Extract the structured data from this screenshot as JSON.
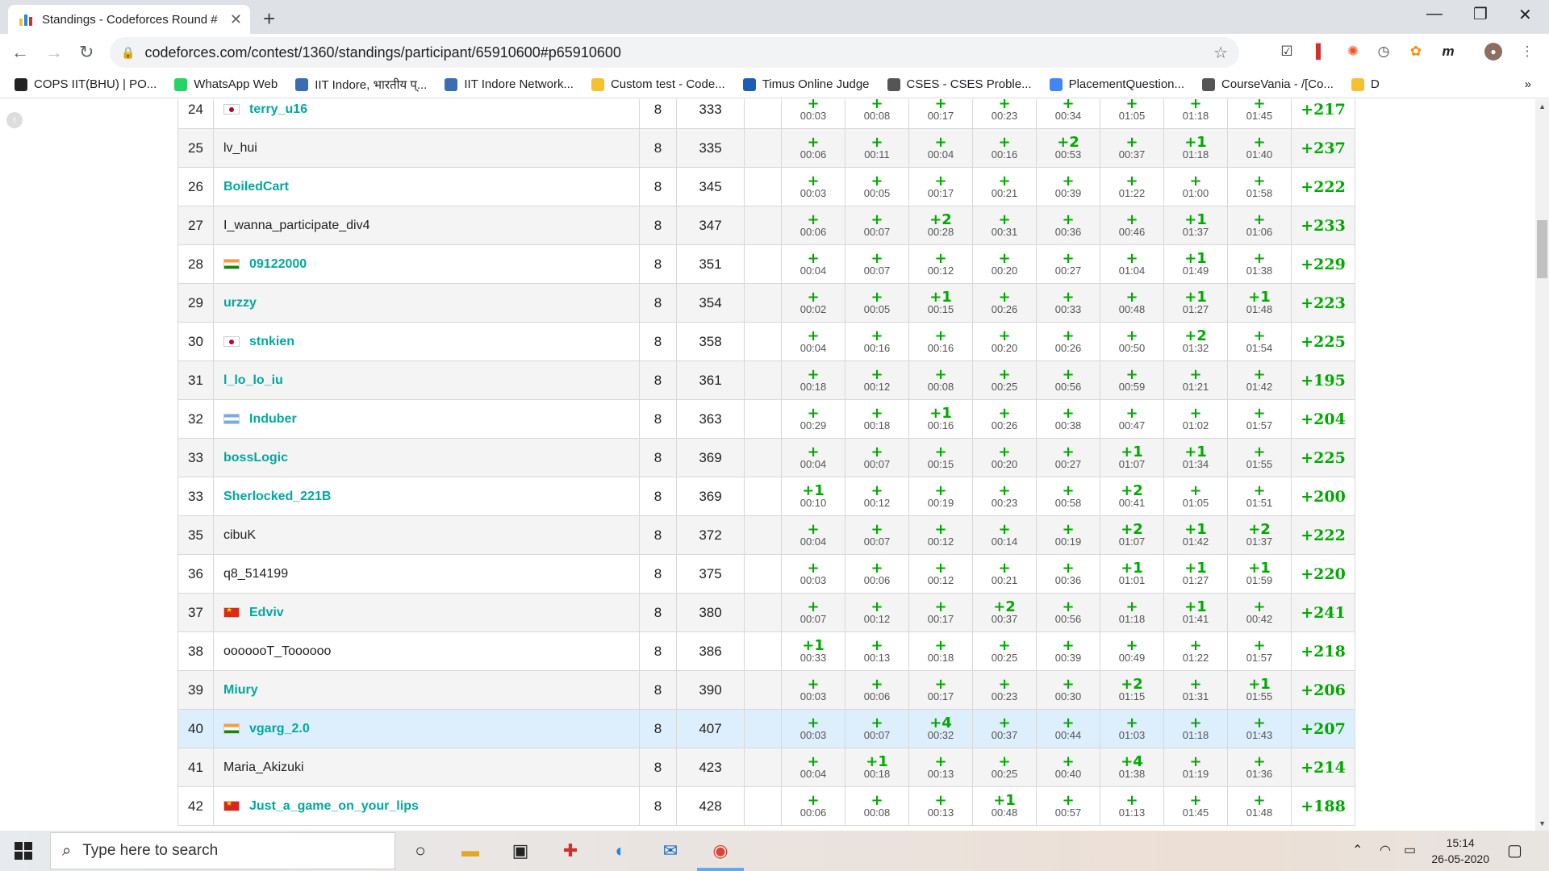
{
  "browser": {
    "tab_title": "Standings - Codeforces Round #",
    "url": "codeforces.com/contest/1360/standings/participant/65910600#p65910600",
    "bookmarks": [
      {
        "label": "COPS IIT(BHU) | PO...",
        "icon": "cops-icon",
        "color": "#222"
      },
      {
        "label": "WhatsApp Web",
        "icon": "whatsapp-icon",
        "color": "#25d366"
      },
      {
        "label": "IIT Indore, भारतीय प्...",
        "icon": "iit-indore-icon",
        "color": "#3b6db3"
      },
      {
        "label": "IIT Indore Network...",
        "icon": "iit-network-icon",
        "color": "#3b6db3"
      },
      {
        "label": "Custom test - Code...",
        "icon": "codeforces-icon",
        "color": "#f6c12f"
      },
      {
        "label": "Timus Online Judge",
        "icon": "timus-icon",
        "color": "#1a5fb4"
      },
      {
        "label": "CSES - CSES Proble...",
        "icon": "globe-icon",
        "color": "#555"
      },
      {
        "label": "PlacementQuestion...",
        "icon": "docs-icon",
        "color": "#4285f4"
      },
      {
        "label": "CourseVania - /[Co...",
        "icon": "globe-icon",
        "color": "#555"
      },
      {
        "label": "D",
        "icon": "codeforces-icon",
        "color": "#f6c12f"
      }
    ],
    "overflow_label": "»"
  },
  "standings": {
    "rows": [
      {
        "rank": "24",
        "handle": "terry_u16",
        "rated": true,
        "flag": "jp",
        "solved": "8",
        "penalty": "333",
        "problems": [
          [
            "+",
            "00:03"
          ],
          [
            "+",
            "00:08"
          ],
          [
            "+",
            "00:17"
          ],
          [
            "+",
            "00:23"
          ],
          [
            "+",
            "00:34"
          ],
          [
            "+",
            "01:05"
          ],
          [
            "+",
            "01:18"
          ],
          [
            "+",
            "01:45"
          ]
        ],
        "total": "+217"
      },
      {
        "rank": "25",
        "handle": "lv_hui",
        "rated": false,
        "flag": "",
        "solved": "8",
        "penalty": "335",
        "problems": [
          [
            "+",
            "00:06"
          ],
          [
            "+",
            "00:11"
          ],
          [
            "+",
            "00:04"
          ],
          [
            "+",
            "00:16"
          ],
          [
            "+2",
            "00:53"
          ],
          [
            "+",
            "00:37"
          ],
          [
            "+1",
            "01:18"
          ],
          [
            "+",
            "01:40"
          ]
        ],
        "total": "+237"
      },
      {
        "rank": "26",
        "handle": "BoiledCart",
        "rated": true,
        "flag": "",
        "solved": "8",
        "penalty": "345",
        "problems": [
          [
            "+",
            "00:03"
          ],
          [
            "+",
            "00:05"
          ],
          [
            "+",
            "00:17"
          ],
          [
            "+",
            "00:21"
          ],
          [
            "+",
            "00:39"
          ],
          [
            "+",
            "01:22"
          ],
          [
            "+",
            "01:00"
          ],
          [
            "+",
            "01:58"
          ]
        ],
        "total": "+222"
      },
      {
        "rank": "27",
        "handle": "I_wanna_participate_div4",
        "rated": false,
        "flag": "",
        "solved": "8",
        "penalty": "347",
        "problems": [
          [
            "+",
            "00:06"
          ],
          [
            "+",
            "00:07"
          ],
          [
            "+2",
            "00:28"
          ],
          [
            "+",
            "00:31"
          ],
          [
            "+",
            "00:36"
          ],
          [
            "+",
            "00:46"
          ],
          [
            "+1",
            "01:37"
          ],
          [
            "+",
            "01:06"
          ]
        ],
        "total": "+233"
      },
      {
        "rank": "28",
        "handle": "09122000",
        "rated": true,
        "flag": "in",
        "solved": "8",
        "penalty": "351",
        "problems": [
          [
            "+",
            "00:04"
          ],
          [
            "+",
            "00:07"
          ],
          [
            "+",
            "00:12"
          ],
          [
            "+",
            "00:20"
          ],
          [
            "+",
            "00:27"
          ],
          [
            "+",
            "01:04"
          ],
          [
            "+1",
            "01:49"
          ],
          [
            "+",
            "01:38"
          ]
        ],
        "total": "+229"
      },
      {
        "rank": "29",
        "handle": "urzzy",
        "rated": true,
        "flag": "",
        "solved": "8",
        "penalty": "354",
        "problems": [
          [
            "+",
            "00:02"
          ],
          [
            "+",
            "00:05"
          ],
          [
            "+1",
            "00:15"
          ],
          [
            "+",
            "00:26"
          ],
          [
            "+",
            "00:33"
          ],
          [
            "+",
            "00:48"
          ],
          [
            "+1",
            "01:27"
          ],
          [
            "+1",
            "01:48"
          ]
        ],
        "total": "+223"
      },
      {
        "rank": "30",
        "handle": "stnkien",
        "rated": true,
        "flag": "jp",
        "solved": "8",
        "penalty": "358",
        "problems": [
          [
            "+",
            "00:04"
          ],
          [
            "+",
            "00:16"
          ],
          [
            "+",
            "00:16"
          ],
          [
            "+",
            "00:20"
          ],
          [
            "+",
            "00:26"
          ],
          [
            "+",
            "00:50"
          ],
          [
            "+2",
            "01:32"
          ],
          [
            "+",
            "01:54"
          ]
        ],
        "total": "+225"
      },
      {
        "rank": "31",
        "handle": "l_lo_lo_iu",
        "rated": true,
        "flag": "",
        "solved": "8",
        "penalty": "361",
        "problems": [
          [
            "+",
            "00:18"
          ],
          [
            "+",
            "00:12"
          ],
          [
            "+",
            "00:08"
          ],
          [
            "+",
            "00:25"
          ],
          [
            "+",
            "00:56"
          ],
          [
            "+",
            "00:59"
          ],
          [
            "+",
            "01:21"
          ],
          [
            "+",
            "01:42"
          ]
        ],
        "total": "+195"
      },
      {
        "rank": "32",
        "handle": "Induber",
        "rated": true,
        "flag": "ar",
        "solved": "8",
        "penalty": "363",
        "problems": [
          [
            "+",
            "00:29"
          ],
          [
            "+",
            "00:18"
          ],
          [
            "+1",
            "00:16"
          ],
          [
            "+",
            "00:26"
          ],
          [
            "+",
            "00:38"
          ],
          [
            "+",
            "00:47"
          ],
          [
            "+",
            "01:02"
          ],
          [
            "+",
            "01:57"
          ]
        ],
        "total": "+204"
      },
      {
        "rank": "33",
        "handle": "bossLogic",
        "rated": true,
        "flag": "",
        "solved": "8",
        "penalty": "369",
        "problems": [
          [
            "+",
            "00:04"
          ],
          [
            "+",
            "00:07"
          ],
          [
            "+",
            "00:15"
          ],
          [
            "+",
            "00:20"
          ],
          [
            "+",
            "00:27"
          ],
          [
            "+1",
            "01:07"
          ],
          [
            "+1",
            "01:34"
          ],
          [
            "+",
            "01:55"
          ]
        ],
        "total": "+225"
      },
      {
        "rank": "33",
        "handle": "Sherlocked_221B",
        "rated": true,
        "flag": "",
        "solved": "8",
        "penalty": "369",
        "problems": [
          [
            "+1",
            "00:10"
          ],
          [
            "+",
            "00:12"
          ],
          [
            "+",
            "00:19"
          ],
          [
            "+",
            "00:23"
          ],
          [
            "+",
            "00:58"
          ],
          [
            "+2",
            "00:41"
          ],
          [
            "+",
            "01:05"
          ],
          [
            "+",
            "01:51"
          ]
        ],
        "total": "+200"
      },
      {
        "rank": "35",
        "handle": "cibuK",
        "rated": false,
        "flag": "",
        "solved": "8",
        "penalty": "372",
        "problems": [
          [
            "+",
            "00:04"
          ],
          [
            "+",
            "00:07"
          ],
          [
            "+",
            "00:12"
          ],
          [
            "+",
            "00:14"
          ],
          [
            "+",
            "00:19"
          ],
          [
            "+2",
            "01:07"
          ],
          [
            "+1",
            "01:42"
          ],
          [
            "+2",
            "01:37"
          ]
        ],
        "total": "+222"
      },
      {
        "rank": "36",
        "handle": "q8_514199",
        "rated": false,
        "flag": "",
        "solved": "8",
        "penalty": "375",
        "problems": [
          [
            "+",
            "00:03"
          ],
          [
            "+",
            "00:06"
          ],
          [
            "+",
            "00:12"
          ],
          [
            "+",
            "00:21"
          ],
          [
            "+",
            "00:36"
          ],
          [
            "+1",
            "01:01"
          ],
          [
            "+1",
            "01:27"
          ],
          [
            "+1",
            "01:59"
          ]
        ],
        "total": "+220"
      },
      {
        "rank": "37",
        "handle": "Edviv",
        "rated": true,
        "flag": "cn",
        "solved": "8",
        "penalty": "380",
        "problems": [
          [
            "+",
            "00:07"
          ],
          [
            "+",
            "00:12"
          ],
          [
            "+",
            "00:17"
          ],
          [
            "+2",
            "00:37"
          ],
          [
            "+",
            "00:56"
          ],
          [
            "+",
            "01:18"
          ],
          [
            "+1",
            "01:41"
          ],
          [
            "+",
            "00:42"
          ]
        ],
        "total": "+241"
      },
      {
        "rank": "38",
        "handle": "ooooooT_Toooooo",
        "rated": false,
        "flag": "",
        "solved": "8",
        "penalty": "386",
        "problems": [
          [
            "+1",
            "00:33"
          ],
          [
            "+",
            "00:13"
          ],
          [
            "+",
            "00:18"
          ],
          [
            "+",
            "00:25"
          ],
          [
            "+",
            "00:39"
          ],
          [
            "+",
            "00:49"
          ],
          [
            "+",
            "01:22"
          ],
          [
            "+",
            "01:57"
          ]
        ],
        "total": "+218"
      },
      {
        "rank": "39",
        "handle": "Miury",
        "rated": true,
        "flag": "",
        "solved": "8",
        "penalty": "390",
        "problems": [
          [
            "+",
            "00:03"
          ],
          [
            "+",
            "00:06"
          ],
          [
            "+",
            "00:17"
          ],
          [
            "+",
            "00:23"
          ],
          [
            "+",
            "00:30"
          ],
          [
            "+2",
            "01:15"
          ],
          [
            "+",
            "01:31"
          ],
          [
            "+1",
            "01:55"
          ]
        ],
        "total": "+206"
      },
      {
        "rank": "40",
        "handle": "vgarg_2.0",
        "rated": true,
        "flag": "in",
        "highlight": true,
        "solved": "8",
        "penalty": "407",
        "problems": [
          [
            "+",
            "00:03"
          ],
          [
            "+",
            "00:07"
          ],
          [
            "+4",
            "00:32"
          ],
          [
            "+",
            "00:37"
          ],
          [
            "+",
            "00:44"
          ],
          [
            "+",
            "01:03"
          ],
          [
            "+",
            "01:18"
          ],
          [
            "+",
            "01:43"
          ]
        ],
        "total": "+207"
      },
      {
        "rank": "41",
        "handle": "Maria_Akizuki",
        "rated": false,
        "flag": "",
        "solved": "8",
        "penalty": "423",
        "problems": [
          [
            "+",
            "00:04"
          ],
          [
            "+1",
            "00:18"
          ],
          [
            "+",
            "00:13"
          ],
          [
            "+",
            "00:25"
          ],
          [
            "+",
            "00:40"
          ],
          [
            "+4",
            "01:38"
          ],
          [
            "+",
            "01:19"
          ],
          [
            "+",
            "01:36"
          ]
        ],
        "total": "+214"
      },
      {
        "rank": "42",
        "handle": "Just_a_game_on_your_lips",
        "rated": true,
        "flag": "vn",
        "solved": "8",
        "penalty": "428",
        "problems": [
          [
            "+",
            "00:06"
          ],
          [
            "+",
            "00:08"
          ],
          [
            "+",
            "00:13"
          ],
          [
            "+1",
            "00:48"
          ],
          [
            "+",
            "00:57"
          ],
          [
            "+",
            "01:13"
          ],
          [
            "+",
            "01:45"
          ],
          [
            "+",
            "01:48"
          ]
        ],
        "total": "+188"
      }
    ]
  },
  "taskbar": {
    "search_placeholder": "Type here to search",
    "time": "15:14",
    "date": "26-05-2020"
  },
  "colors": {
    "accepted": "#00aa00",
    "rated_handle": "#03a89e",
    "highlight_row": "#ddeefc"
  }
}
